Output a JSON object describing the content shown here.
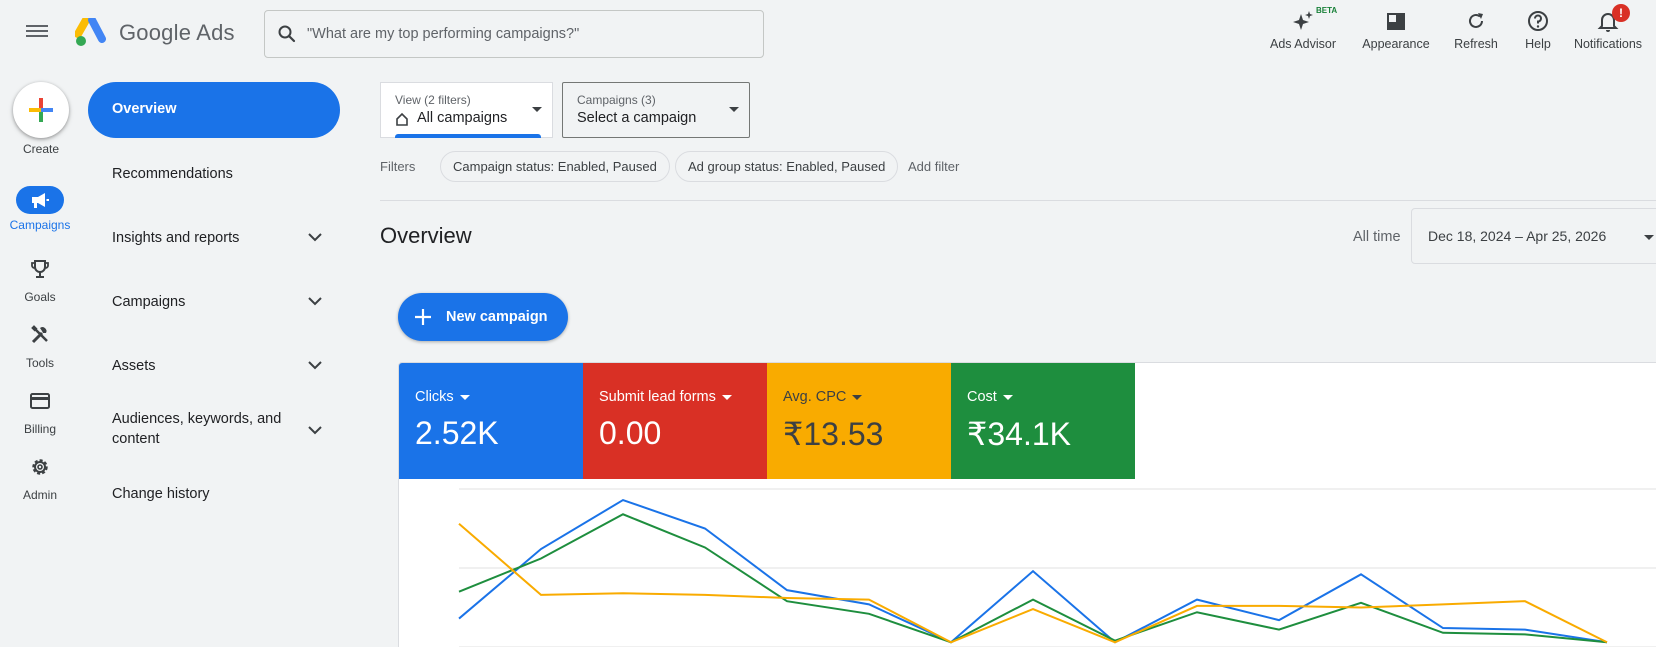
{
  "header": {
    "brand": "Google Ads",
    "search_placeholder": "\"What are my top performing campaigns?\"",
    "tools": [
      {
        "label": "Ads Advisor",
        "icon": "sparkle-icon",
        "badge": "BETA"
      },
      {
        "label": "Appearance",
        "icon": "appearance-icon"
      },
      {
        "label": "Refresh",
        "icon": "refresh-icon"
      },
      {
        "label": "Help",
        "icon": "help-icon"
      },
      {
        "label": "Notifications",
        "icon": "bell-icon",
        "badge": "!"
      }
    ]
  },
  "rail": {
    "create_label": "Create",
    "items": [
      {
        "label": "Campaigns",
        "icon": "megaphone-icon",
        "active": true
      },
      {
        "label": "Goals",
        "icon": "trophy-icon"
      },
      {
        "label": "Tools",
        "icon": "tools-icon"
      },
      {
        "label": "Billing",
        "icon": "credit-card-icon"
      },
      {
        "label": "Admin",
        "icon": "gear-icon"
      }
    ]
  },
  "nav": {
    "items": [
      {
        "label": "Overview",
        "active": true
      },
      {
        "label": "Recommendations"
      },
      {
        "label": "Insights and reports",
        "expandable": true
      },
      {
        "label": "Campaigns",
        "expandable": true
      },
      {
        "label": "Assets",
        "expandable": true
      },
      {
        "label": "Audiences, keywords, and",
        "label2": "content",
        "expandable": true
      },
      {
        "label": "Change history"
      }
    ]
  },
  "main": {
    "view_selector": {
      "sub": "View (2 filters)",
      "value": "All campaigns"
    },
    "campaign_selector": {
      "sub": "Campaigns (3)",
      "value": "Select a campaign"
    },
    "filters_label": "Filters",
    "filter_chips": [
      "Campaign status: Enabled, Paused",
      "Ad group status: Enabled, Paused"
    ],
    "add_filter": "Add filter",
    "title": "Overview",
    "date_prefix": "All time",
    "date_range": "Dec 18, 2024 – Apr 25, 2026",
    "new_campaign": "New campaign",
    "metrics": [
      {
        "name": "Clicks",
        "value": "2.52K",
        "color": "#1a73e8"
      },
      {
        "name": "Submit lead forms",
        "value": "0.00",
        "color": "#d93025"
      },
      {
        "name": "Avg. CPC",
        "value": "₹13.53",
        "color": "#f9ab00"
      },
      {
        "name": "Cost",
        "value": "₹34.1K",
        "color": "#1e8e3e"
      }
    ]
  },
  "chart_data": {
    "type": "line",
    "x": [
      0,
      1,
      2,
      3,
      4,
      5,
      6,
      7,
      8,
      9,
      10,
      11,
      12,
      13,
      14
    ],
    "ylim": [
      0,
      100
    ],
    "grid": true,
    "series": [
      {
        "values": [
          18,
          62,
          93,
          75,
          36,
          27,
          3,
          48,
          3,
          30,
          17,
          46,
          12,
          11,
          3
        ],
        "color": "#1a73e8"
      },
      {
        "values": [
          35,
          56,
          84,
          63,
          29,
          21,
          3,
          30,
          4,
          22,
          11,
          28,
          9,
          8,
          3
        ],
        "color": "#1e8e3e"
      },
      {
        "values": [
          78,
          33,
          34,
          33,
          31,
          30,
          3,
          24,
          3,
          26,
          26,
          25,
          27,
          29,
          3
        ],
        "color": "#f9ab00"
      }
    ]
  }
}
